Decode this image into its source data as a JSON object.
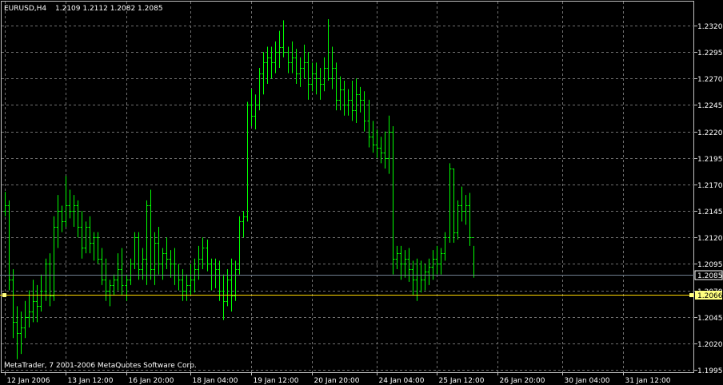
{
  "header": {
    "symbol_label": "EURUSD,H4",
    "ohlc_label": "1.2109 1.2112 1.2082 1.2085"
  },
  "footer": {
    "copyright": "MetaTrader, 7 2001-2006 MetaQuotes Software Corp."
  },
  "colors": {
    "background": "#000000",
    "bars": "#00ff00",
    "grid": "#707070",
    "text": "#ffffff",
    "bid_line": "#708090",
    "hline": "#ffd700",
    "hline_label_bg": "#ffff80"
  },
  "chart_data": {
    "type": "bar",
    "ylim": [
      1.1988,
      1.2332
    ],
    "y_ticks": [
      "1.2320",
      "1.2295",
      "1.2270",
      "1.2245",
      "1.2220",
      "1.2195",
      "1.2170",
      "1.2145",
      "1.2120",
      "1.2095",
      "1.2070",
      "1.2045",
      "1.2020",
      "1.1995"
    ],
    "x_ticks": [
      {
        "label": "12 Jan 2006",
        "bar": 0
      },
      {
        "label": "13 Jan 12:00",
        "bar": 15
      },
      {
        "label": "16 Jan 20:00",
        "bar": 30
      },
      {
        "label": "18 Jan 04:00",
        "bar": 46
      },
      {
        "label": "19 Jan 12:00",
        "bar": 61
      },
      {
        "label": "20 Jan 20:00",
        "bar": 76
      },
      {
        "label": "24 Jan 04:00",
        "bar": 92
      },
      {
        "label": "25 Jan 12:00",
        "bar": 107
      },
      {
        "label": "26 Jan 20:00",
        "bar": 122
      },
      {
        "label": "30 Jan 04:00",
        "bar": 138
      },
      {
        "label": "31 Jan 12:00",
        "bar": 153
      }
    ],
    "bid_line": 1.2085,
    "bid_label": "1.2085",
    "horizontal_line": 1.2066,
    "horizontal_line_label": "1.2066",
    "grid": true,
    "bars_ohlc": [
      [
        1.2145,
        1.2163,
        1.214,
        1.215
      ],
      [
        1.215,
        1.2155,
        1.207,
        1.208
      ],
      [
        1.208,
        1.209,
        1.2025,
        1.204
      ],
      [
        1.204,
        1.2055,
        1.2005,
        1.203
      ],
      [
        1.203,
        1.205,
        1.201,
        1.2035
      ],
      [
        1.2035,
        1.206,
        1.2025,
        1.2045
      ],
      [
        1.2045,
        1.207,
        1.2035,
        1.205
      ],
      [
        1.205,
        1.208,
        1.204,
        1.206
      ],
      [
        1.206,
        1.2075,
        1.204,
        1.2055
      ],
      [
        1.2055,
        1.2085,
        1.205,
        1.207
      ],
      [
        1.207,
        1.21,
        1.206,
        1.2095
      ],
      [
        1.2095,
        1.2105,
        1.2055,
        1.2065
      ],
      [
        1.2065,
        1.214,
        1.206,
        1.213
      ],
      [
        1.213,
        1.216,
        1.211,
        1.2145
      ],
      [
        1.2145,
        1.215,
        1.2125,
        1.2135
      ],
      [
        1.2135,
        1.2178,
        1.213,
        1.215
      ],
      [
        1.215,
        1.2165,
        1.2138,
        1.2145
      ],
      [
        1.2145,
        1.216,
        1.213,
        1.215
      ],
      [
        1.215,
        1.2155,
        1.212,
        1.213
      ],
      [
        1.213,
        1.2145,
        1.21,
        1.211
      ],
      [
        1.211,
        1.2135,
        1.2105,
        1.213
      ],
      [
        1.213,
        1.214,
        1.2105,
        1.2115
      ],
      [
        1.2115,
        1.2125,
        1.2098,
        1.212
      ],
      [
        1.212,
        1.2125,
        1.2095,
        1.21
      ],
      [
        1.21,
        1.211,
        1.2075,
        1.208
      ],
      [
        1.208,
        1.21,
        1.206,
        1.207
      ],
      [
        1.207,
        1.208,
        1.2055,
        1.2075
      ],
      [
        1.2075,
        1.2085,
        1.2065,
        1.208
      ],
      [
        1.208,
        1.2105,
        1.207,
        1.209
      ],
      [
        1.209,
        1.211,
        1.2065,
        1.2075
      ],
      [
        1.2075,
        1.2085,
        1.206,
        1.208
      ],
      [
        1.208,
        1.21,
        1.2075,
        1.2095
      ],
      [
        1.2095,
        1.2125,
        1.209,
        1.212
      ],
      [
        1.212,
        1.2125,
        1.208,
        1.209
      ],
      [
        1.209,
        1.211,
        1.208,
        1.21
      ],
      [
        1.21,
        1.2155,
        1.2075,
        1.215
      ],
      [
        1.215,
        1.2165,
        1.208,
        1.209
      ],
      [
        1.209,
        1.2125,
        1.2075,
        1.2115
      ],
      [
        1.2115,
        1.213,
        1.2085,
        1.2095
      ],
      [
        1.2095,
        1.211,
        1.208,
        1.2105
      ],
      [
        1.2105,
        1.212,
        1.209,
        1.21
      ],
      [
        1.21,
        1.2108,
        1.2082,
        1.2095
      ],
      [
        1.2095,
        1.211,
        1.2075,
        1.2085
      ],
      [
        1.2085,
        1.2095,
        1.207,
        1.208
      ],
      [
        1.208,
        1.209,
        1.206,
        1.207
      ],
      [
        1.207,
        1.2085,
        1.206,
        1.2075
      ],
      [
        1.2075,
        1.2095,
        1.2065,
        1.208
      ],
      [
        1.208,
        1.21,
        1.2068,
        1.209
      ],
      [
        1.209,
        1.2112,
        1.208,
        1.21
      ],
      [
        1.21,
        1.212,
        1.209,
        1.211
      ],
      [
        1.211,
        1.2118,
        1.2088,
        1.2095
      ],
      [
        1.2095,
        1.21,
        1.207,
        1.2085
      ],
      [
        1.2085,
        1.21,
        1.2072,
        1.209
      ],
      [
        1.209,
        1.2098,
        1.206,
        1.207
      ],
      [
        1.207,
        1.2085,
        1.2042,
        1.206
      ],
      [
        1.206,
        1.209,
        1.2055,
        1.208
      ],
      [
        1.208,
        1.21,
        1.205,
        1.2065
      ],
      [
        1.2065,
        1.2098,
        1.206,
        1.209
      ],
      [
        1.209,
        1.214,
        1.2085,
        1.2135
      ],
      [
        1.2135,
        1.2145,
        1.212,
        1.214
      ],
      [
        1.214,
        1.2248,
        1.2135,
        1.2245
      ],
      [
        1.2245,
        1.226,
        1.2225,
        1.2235
      ],
      [
        1.2235,
        1.2255,
        1.2222,
        1.2245
      ],
      [
        1.2245,
        1.228,
        1.224,
        1.2275
      ],
      [
        1.2275,
        1.2295,
        1.2255,
        1.2285
      ],
      [
        1.2285,
        1.23,
        1.2265,
        1.229
      ],
      [
        1.229,
        1.23,
        1.227,
        1.2285
      ],
      [
        1.2285,
        1.2305,
        1.2275,
        1.2295
      ],
      [
        1.2295,
        1.2315,
        1.228,
        1.23
      ],
      [
        1.23,
        1.2325,
        1.229,
        1.2295
      ],
      [
        1.2295,
        1.23,
        1.2275,
        1.2285
      ],
      [
        1.2285,
        1.2305,
        1.2275,
        1.229
      ],
      [
        1.229,
        1.2298,
        1.2265,
        1.2275
      ],
      [
        1.2275,
        1.229,
        1.2262,
        1.228
      ],
      [
        1.228,
        1.2302,
        1.227,
        1.2285
      ],
      [
        1.2285,
        1.2295,
        1.225,
        1.2265
      ],
      [
        1.2265,
        1.2285,
        1.2258,
        1.2275
      ],
      [
        1.2275,
        1.2285,
        1.2255,
        1.227
      ],
      [
        1.227,
        1.228,
        1.225,
        1.2265
      ],
      [
        1.2265,
        1.229,
        1.2258,
        1.228
      ],
      [
        1.228,
        1.2326,
        1.2268,
        1.227
      ],
      [
        1.227,
        1.23,
        1.226,
        1.228
      ],
      [
        1.228,
        1.2285,
        1.224,
        1.225
      ],
      [
        1.225,
        1.2272,
        1.224,
        1.226
      ],
      [
        1.226,
        1.2268,
        1.2235,
        1.2245
      ],
      [
        1.2245,
        1.226,
        1.2235,
        1.225
      ],
      [
        1.225,
        1.2268,
        1.223,
        1.224
      ],
      [
        1.224,
        1.227,
        1.2228,
        1.2255
      ],
      [
        1.2255,
        1.2262,
        1.2238,
        1.225
      ],
      [
        1.225,
        1.2258,
        1.222,
        1.223
      ],
      [
        1.223,
        1.225,
        1.2205,
        1.2215
      ],
      [
        1.2215,
        1.223,
        1.22,
        1.2208
      ],
      [
        1.2208,
        1.2222,
        1.2195,
        1.2205
      ],
      [
        1.2205,
        1.2215,
        1.219,
        1.22
      ],
      [
        1.22,
        1.222,
        1.2185,
        1.2195
      ],
      [
        1.2195,
        1.2235,
        1.218,
        1.222
      ],
      [
        1.222,
        1.2225,
        1.2085,
        1.21
      ],
      [
        1.21,
        1.2112,
        1.209,
        1.2105
      ],
      [
        1.2105,
        1.2112,
        1.208,
        1.2095
      ],
      [
        1.2095,
        1.2108,
        1.2082,
        1.21
      ],
      [
        1.21,
        1.211,
        1.2078,
        1.209
      ],
      [
        1.209,
        1.2098,
        1.2065,
        1.208
      ],
      [
        1.208,
        1.21,
        1.206,
        1.2085
      ],
      [
        1.2085,
        1.2098,
        1.2068,
        1.208
      ],
      [
        1.208,
        1.2095,
        1.207,
        1.2088
      ],
      [
        1.2088,
        1.21,
        1.2075,
        1.2092
      ],
      [
        1.2092,
        1.2108,
        1.208,
        1.21
      ],
      [
        1.21,
        1.2112,
        1.2085,
        1.2095
      ],
      [
        1.2095,
        1.211,
        1.2085,
        1.2105
      ],
      [
        1.2105,
        1.2125,
        1.2098,
        1.212
      ],
      [
        1.212,
        1.219,
        1.2115,
        1.2185
      ],
      [
        1.2185,
        1.2185,
        1.2115,
        1.2125
      ],
      [
        1.2125,
        1.2155,
        1.2118,
        1.215
      ],
      [
        1.215,
        1.2168,
        1.2135,
        1.2145
      ],
      [
        1.2145,
        1.216,
        1.2132,
        1.215
      ],
      [
        1.215,
        1.2162,
        1.2112,
        1.212
      ],
      [
        1.212,
        1.2112,
        1.2082,
        1.2085
      ]
    ]
  }
}
